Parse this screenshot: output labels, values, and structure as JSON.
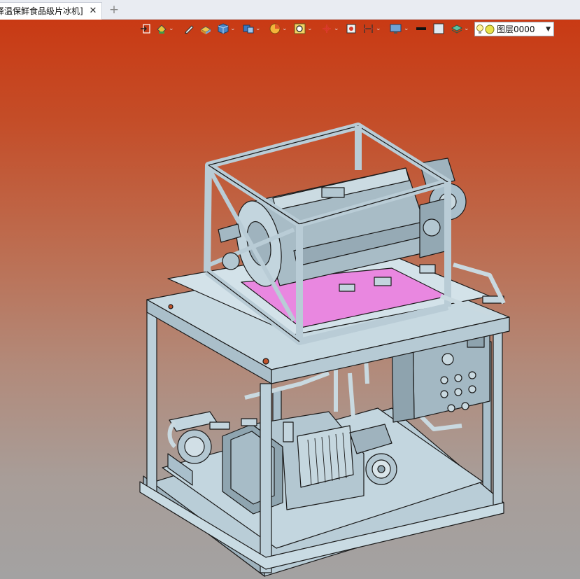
{
  "tabbar": {
    "active_tab": "择温保鲜食品级片冰机]",
    "close_symbol": "✕",
    "new_tab_symbol": "+"
  },
  "toolbar": {
    "tools": [
      "exit-sketch-icon",
      "paint-bucket-icon",
      "pencil-icon",
      "material-icon",
      "view-cube-icon",
      "display-mode-icon",
      "pie-section-icon",
      "zoom-fit-icon",
      "measure-icon",
      "render-icon",
      "dimension-icon",
      "monitor-icon",
      "line-color-icon",
      "fill-color-icon",
      "layer-stack-icon"
    ],
    "layer_value": "图层0000"
  },
  "colors": {
    "viewport_top": "#c93a14",
    "viewport_bottom": "#a3a2a2",
    "model_steel": "#b8ccd6",
    "model_edge": "#1a1a1a",
    "highlight": "#e987e0"
  }
}
